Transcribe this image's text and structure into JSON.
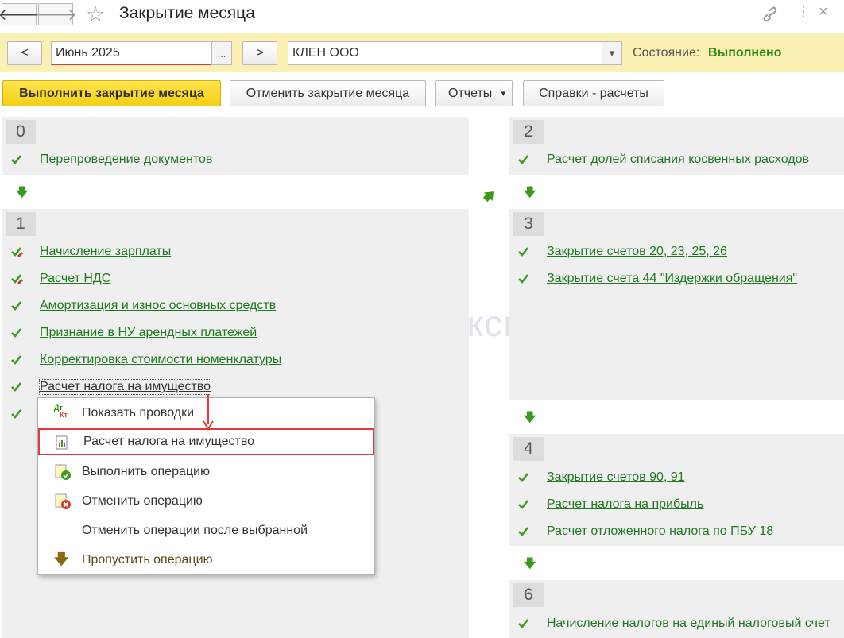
{
  "window": {
    "title": "Закрытие месяца"
  },
  "toolbar": {
    "prev_label": "<",
    "next_label": ">",
    "period_value": "Июнь 2025",
    "period_select_label": "...",
    "organization_value": "КЛЕН ООО",
    "status_label": "Состояние:",
    "status_value": "Выполнено"
  },
  "actions": {
    "run": "Выполнить закрытие месяца",
    "cancel": "Отменить закрытие месяца",
    "reports": "Отчеты",
    "references": "Справки - расчеты"
  },
  "steps": {
    "s0": {
      "number": "0",
      "items": [
        "Перепроведение документов"
      ]
    },
    "s1": {
      "number": "1",
      "items": [
        "Начисление зарплаты",
        "Расчет НДС",
        "Амортизация и износ основных средств",
        "Признание в НУ арендных платежей",
        "Корректировка стоимости номенклатуры",
        "Расчет налога на имущество"
      ]
    },
    "s2": {
      "number": "2",
      "items": [
        "Расчет долей списания косвенных расходов"
      ]
    },
    "s3": {
      "number": "3",
      "items": [
        "Закрытие счетов 20, 23, 25, 26",
        "Закрытие счета 44 \"Издержки обращения\""
      ]
    },
    "s4": {
      "number": "4",
      "items": [
        "Закрытие счетов 90, 91",
        "Расчет налога на прибыль",
        "Расчет отложенного налога по ПБУ 18"
      ]
    },
    "s6": {
      "number": "6",
      "items": [
        "Начисление налогов на единый налоговый счет"
      ]
    }
  },
  "context_menu": {
    "items": [
      "Показать проводки",
      "Расчет налога на имущество",
      "Выполнить операцию",
      "Отменить операцию",
      "Отменить операции после выбранной",
      "Пропустить операцию"
    ],
    "dtkt_dt": "Дт",
    "dtkt_kt": "Кт"
  },
  "watermark": "Бухэксперт",
  "colors": {
    "accent_yellow": "#f7d52a",
    "link_green": "#1f7a1f",
    "status_green": "#2b8a16",
    "highlight_red": "#e0393e"
  }
}
